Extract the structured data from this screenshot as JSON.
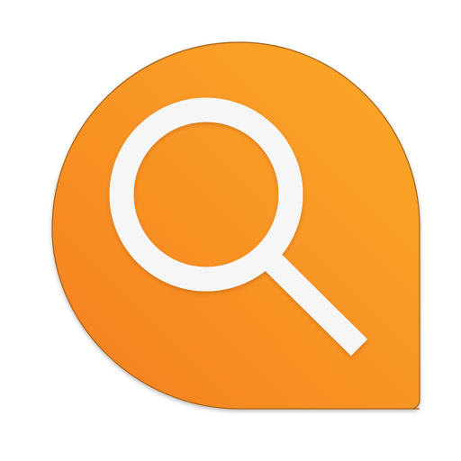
{
  "icon": {
    "name": "search-app-icon",
    "glyph": "magnifying-glass-icon",
    "colors": {
      "background": "#ffffff",
      "gradient_top_right": "#FBAA29",
      "gradient_bottom_left": "#F57F20",
      "glyph": "#F6F6F6",
      "outline": "#A66012"
    }
  }
}
